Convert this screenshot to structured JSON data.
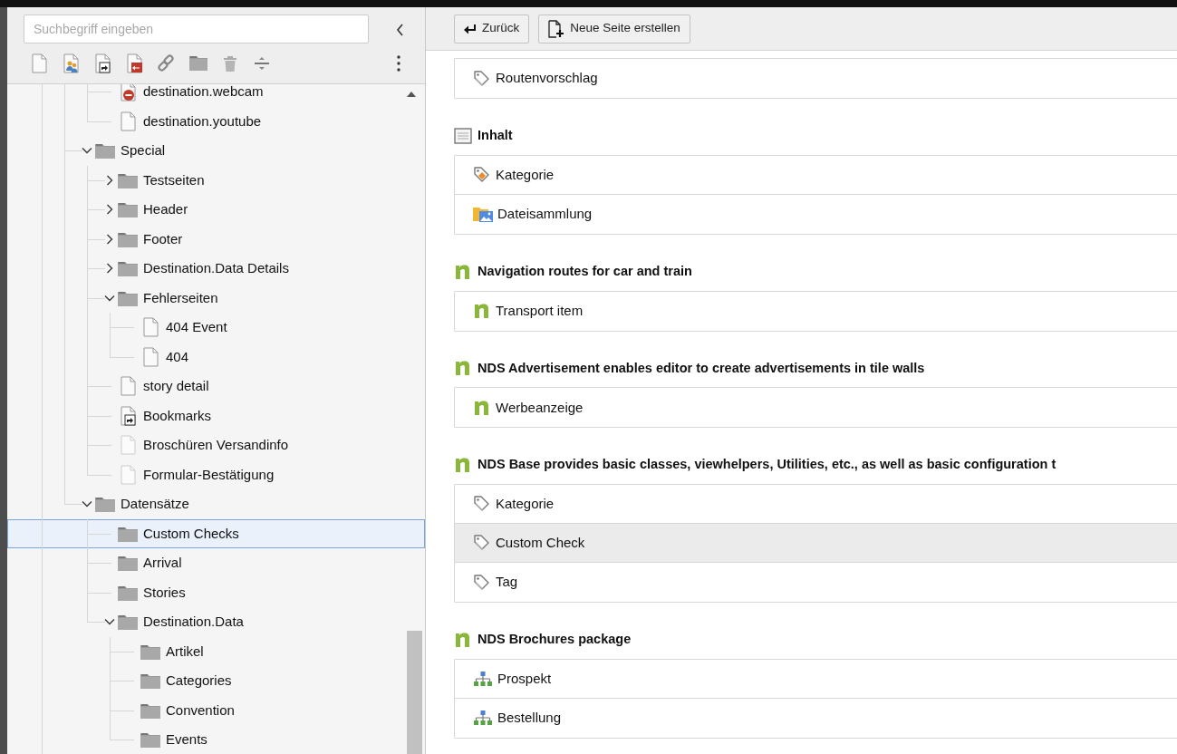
{
  "page_tree": {
    "search": {
      "placeholder": "Suchbegriff eingeben"
    },
    "leading_items": [
      {
        "label": "destination.webcam",
        "kind": "page-blocked",
        "selected": false
      },
      {
        "label": "destination.youtube",
        "kind": "page",
        "selected": false
      }
    ],
    "items": [
      {
        "label": "Special",
        "kind": "folder",
        "expanded": true,
        "selected": false,
        "children": [
          {
            "label": "Testseiten",
            "kind": "folder",
            "expanded": false,
            "selected": false
          },
          {
            "label": "Header",
            "kind": "folder",
            "expanded": false,
            "selected": false
          },
          {
            "label": "Footer",
            "kind": "folder",
            "expanded": false,
            "selected": false
          },
          {
            "label": "Destination.Data Details",
            "kind": "folder",
            "expanded": false,
            "selected": false
          },
          {
            "label": "Fehlerseiten",
            "kind": "folder",
            "expanded": true,
            "selected": false,
            "children": [
              {
                "label": "404 Event",
                "kind": "page",
                "selected": false
              },
              {
                "label": "404",
                "kind": "page",
                "selected": false
              }
            ]
          },
          {
            "label": "story detail",
            "kind": "page",
            "selected": false
          },
          {
            "label": "Bookmarks",
            "kind": "shortcut",
            "selected": false
          },
          {
            "label": "Broschüren Versandinfo",
            "kind": "page-hidden",
            "selected": false
          },
          {
            "label": "Formular-Bestätigung",
            "kind": "page-hidden",
            "selected": false
          }
        ]
      },
      {
        "label": "Datensätze",
        "kind": "folder",
        "expanded": true,
        "selected": false,
        "children": [
          {
            "label": "Custom Checks",
            "kind": "folder",
            "selected": true
          },
          {
            "label": "Arrival",
            "kind": "folder",
            "selected": false
          },
          {
            "label": "Stories",
            "kind": "folder",
            "selected": false
          },
          {
            "label": "Destination.Data",
            "kind": "folder",
            "expanded": true,
            "selected": false,
            "children": [
              {
                "label": "Artikel",
                "kind": "folder",
                "selected": false
              },
              {
                "label": "Categories",
                "kind": "folder",
                "selected": false
              },
              {
                "label": "Convention",
                "kind": "folder",
                "selected": false
              },
              {
                "label": "Events",
                "kind": "folder",
                "selected": false
              }
            ]
          }
        ]
      }
    ]
  },
  "header_buttons": [
    {
      "label": "Zurück",
      "kind": "back"
    },
    {
      "label": "Neue Seite erstellen",
      "kind": "new-page"
    }
  ],
  "sections": [
    {
      "rows": [
        {
          "label": "Routenvorschlag",
          "kind": "tag",
          "hovered": false
        }
      ]
    },
    {
      "title": "Inhalt",
      "kind": "content",
      "rows": [
        {
          "label": "Kategorie",
          "kind": "category-tag",
          "hovered": false
        },
        {
          "label": "Dateisammlung",
          "kind": "file-collection",
          "hovered": false
        }
      ]
    },
    {
      "title": "Navigation routes for car and train",
      "kind": "nds",
      "rows": [
        {
          "label": "Transport item",
          "kind": "nds",
          "hovered": false
        }
      ]
    },
    {
      "title": "NDS Advertisement enables editor to create advertisements in tile walls",
      "kind": "nds",
      "rows": [
        {
          "label": "Werbeanzeige",
          "kind": "nds",
          "hovered": false
        }
      ]
    },
    {
      "title": "NDS Base provides basic classes, viewhelpers, Utilities, etc., as well as basic configuration t",
      "kind": "nds",
      "rows": [
        {
          "label": "Kategorie",
          "kind": "tag",
          "hovered": false
        },
        {
          "label": "Custom Check",
          "kind": "tag",
          "hovered": true
        },
        {
          "label": "Tag",
          "kind": "tag",
          "hovered": false
        }
      ]
    },
    {
      "title": "NDS Brochures package",
      "kind": "nds",
      "rows": [
        {
          "label": "Prospekt",
          "kind": "sitemap",
          "hovered": false
        },
        {
          "label": "Bestellung",
          "kind": "sitemap",
          "hovered": false
        }
      ]
    }
  ]
}
